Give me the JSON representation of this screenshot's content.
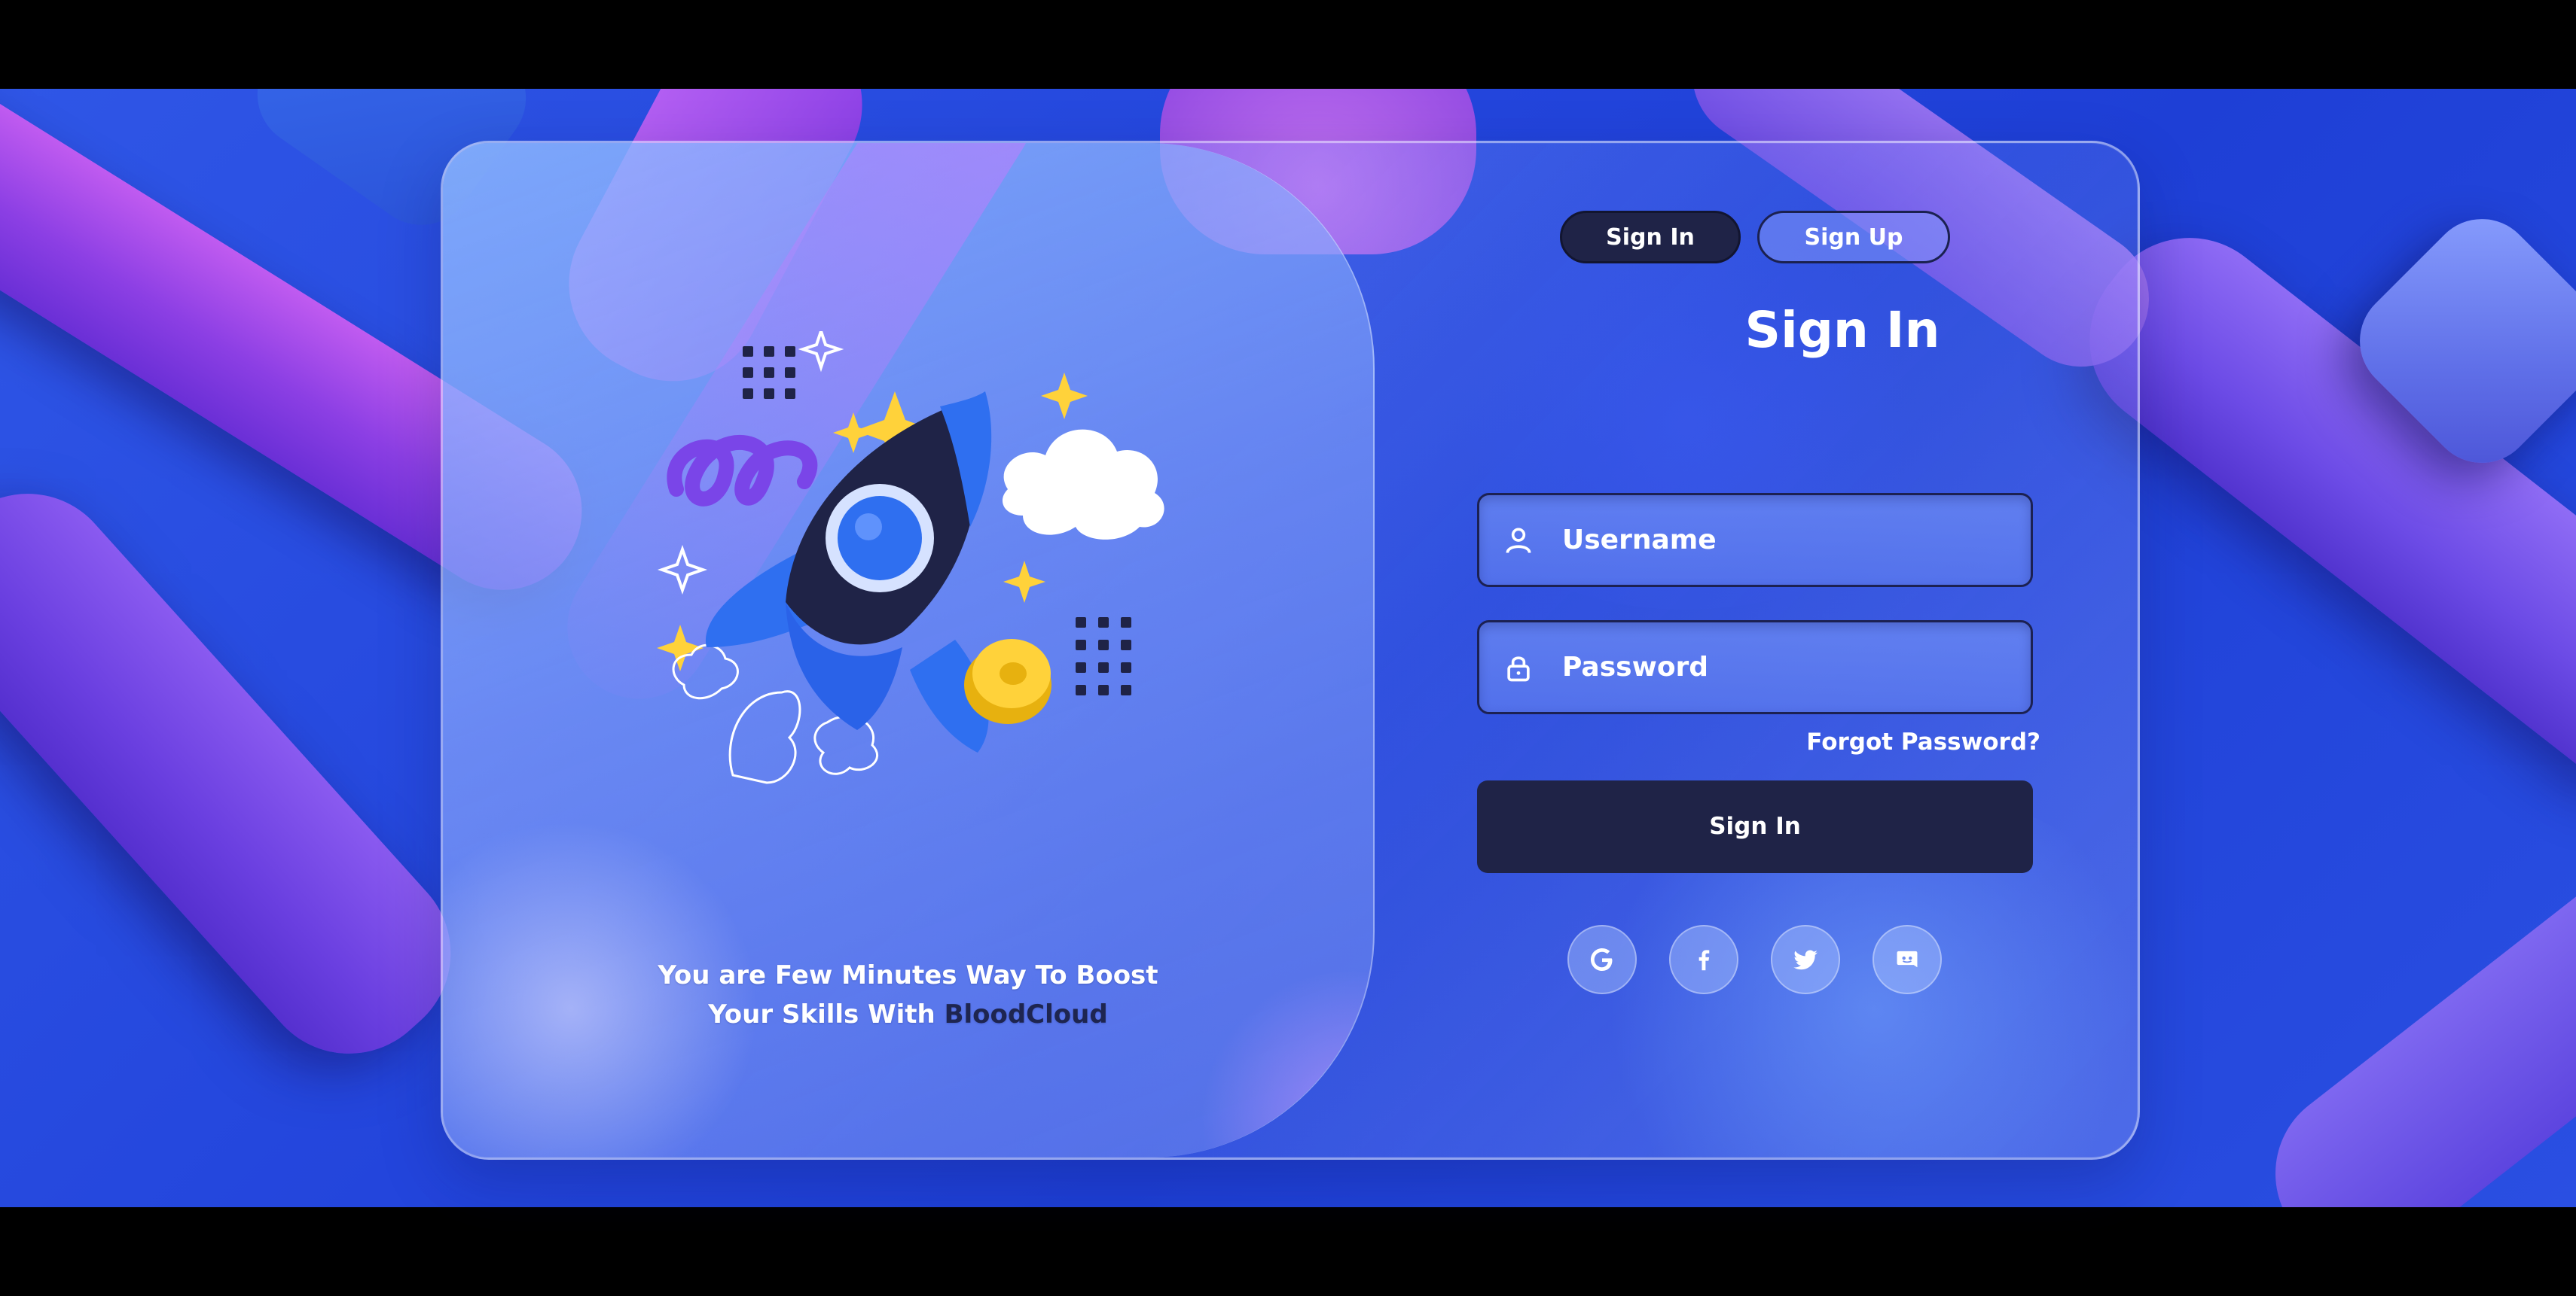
{
  "toggle": {
    "signin_label": "Sign In",
    "signup_label": "Sign Up"
  },
  "form": {
    "title": "Sign In",
    "username_placeholder": "Username",
    "password_placeholder": "Password",
    "forgot_label": "Forgot Password?",
    "submit_label": "Sign In"
  },
  "tagline": {
    "line1": "You are Few Minutes Way To Boost",
    "line2_prefix": "Your Skills With ",
    "brand": "BloodCloud"
  },
  "social": [
    "google-icon",
    "facebook-icon",
    "twitter-icon",
    "discord-icon"
  ],
  "colors": {
    "background_blue": "#2345dc",
    "dark_navy": "#1f2347",
    "accent_purple": "#8c3fe4",
    "text_white": "#ffffff"
  }
}
